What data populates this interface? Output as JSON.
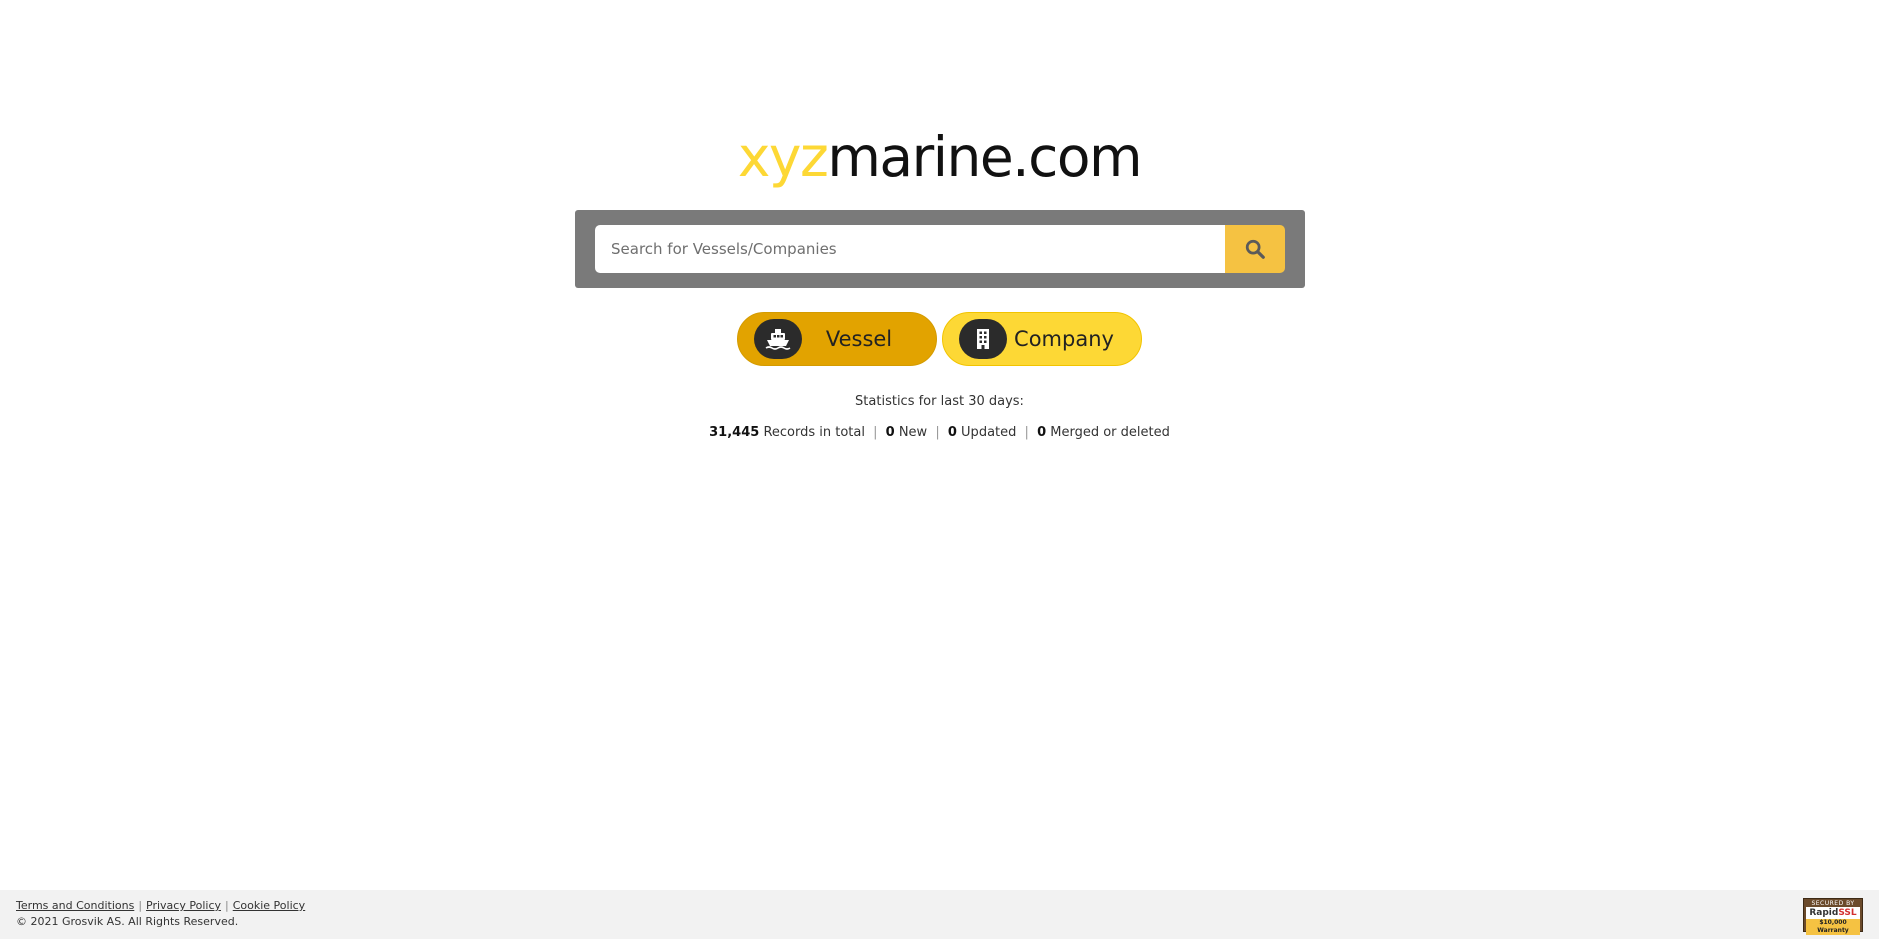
{
  "logo": {
    "accent_text": "xyz",
    "main_text": "marine.com",
    "accent_color": "#fdd835"
  },
  "search": {
    "placeholder": "Search for Vessels/Companies",
    "value": "",
    "button_icon": "search-icon"
  },
  "type_buttons": {
    "vessel": {
      "label": "Vessel",
      "icon": "ship-icon",
      "color": "#e2a300"
    },
    "company": {
      "label": "Company",
      "icon": "building-icon",
      "color": "#fdd835"
    }
  },
  "stats": {
    "title": "Statistics for last 30 days:",
    "records_total": "31,445",
    "records_total_label": "Records in total",
    "new_count": "0",
    "new_label": "New",
    "updated_count": "0",
    "updated_label": "Updated",
    "merged_count": "0",
    "merged_label": "Merged or deleted",
    "separator": "|"
  },
  "footer": {
    "links": {
      "terms": "Terms and Conditions",
      "privacy": "Privacy Policy",
      "cookie": "Cookie Policy"
    },
    "separator": "|",
    "copyright": "© 2021 Grosvik AS. All Rights Reserved.",
    "ssl_badge": {
      "top": "SECURED BY",
      "brand_a": "Rapid",
      "brand_b": "SSL",
      "warranty": "$10,000 Warranty"
    }
  }
}
